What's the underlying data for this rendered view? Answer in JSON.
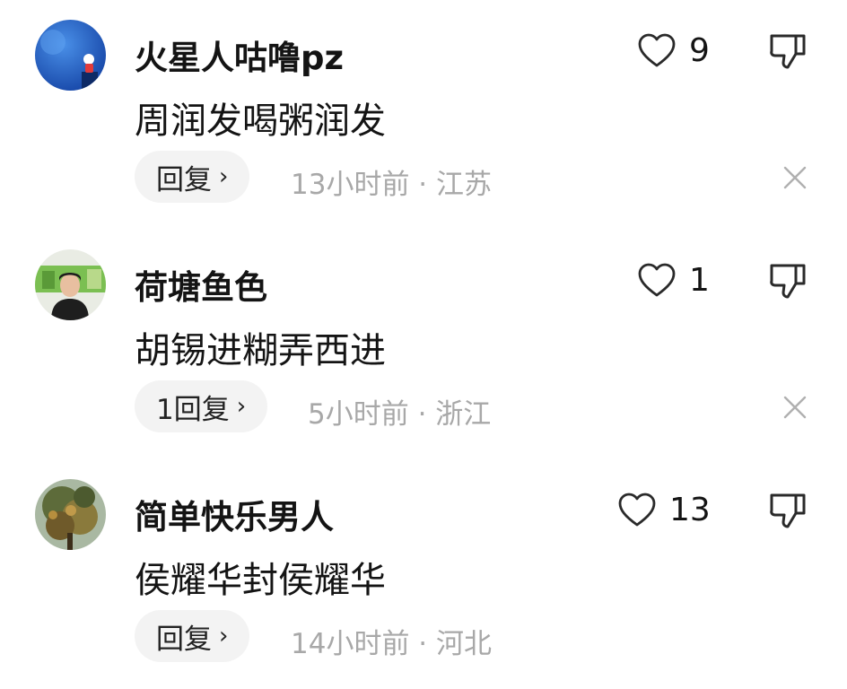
{
  "comments": [
    {
      "username": "火星人咕噜pz",
      "content": "周润发喝粥润发",
      "reply_label": "回复",
      "reply_chevron": "›",
      "meta": "13小时前 · 江苏",
      "likes": "9",
      "avatar_icon": "astronaut-avatar"
    },
    {
      "username": "荷塘鱼色",
      "content": "胡锡进糊弄西进",
      "reply_label": "1回复",
      "reply_chevron": "›",
      "meta": "5小时前 · 浙江",
      "likes": "1",
      "avatar_icon": "person-photo-avatar"
    },
    {
      "username": "简单快乐男人",
      "content": "侯耀华封侯耀华",
      "reply_label": "回复",
      "reply_chevron": "›",
      "meta": "14小时前 · 河北",
      "likes": "13",
      "avatar_icon": "tree-photo-avatar"
    }
  ],
  "colors": {
    "text": "#141414",
    "meta": "#a8a8a8",
    "pill_bg": "#f3f3f3",
    "icon_stroke": "#2a2a2a"
  },
  "icons": [
    "heart-icon",
    "thumbs-down-icon",
    "close-icon",
    "chevron-right-icon"
  ]
}
